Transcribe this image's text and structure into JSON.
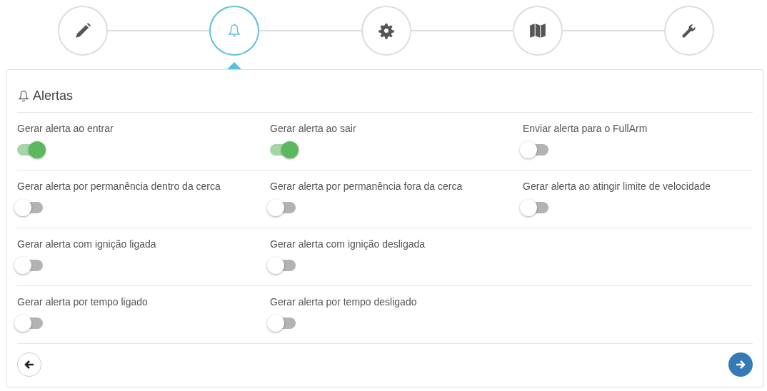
{
  "steps": [
    {
      "kind": "pencil",
      "selected": false
    },
    {
      "kind": "bell",
      "selected": true
    },
    {
      "kind": "gear",
      "selected": false
    },
    {
      "kind": "map",
      "selected": false
    },
    {
      "kind": "wrench",
      "selected": false
    }
  ],
  "panel": {
    "title": "Alertas",
    "rows": [
      [
        {
          "label": "Gerar alerta ao entrar",
          "on": true
        },
        {
          "label": "Gerar alerta ao sair",
          "on": true
        },
        {
          "label": "Enviar alerta para o FullArm",
          "on": false
        }
      ],
      [
        {
          "label": "Gerar alerta por permanência dentro da cerca",
          "on": false
        },
        {
          "label": "Gerar alerta por permanência fora da cerca",
          "on": false
        },
        {
          "label": "Gerar alerta ao atingir limite de velocidade",
          "on": false
        }
      ],
      [
        {
          "label": "Gerar alerta com ignição ligada",
          "on": false
        },
        {
          "label": "Gerar alerta com ignição desligada",
          "on": false
        }
      ],
      [
        {
          "label": "Gerar alerta por tempo ligado",
          "on": false
        },
        {
          "label": "Gerar alerta por tempo desligado",
          "on": false
        }
      ]
    ]
  }
}
